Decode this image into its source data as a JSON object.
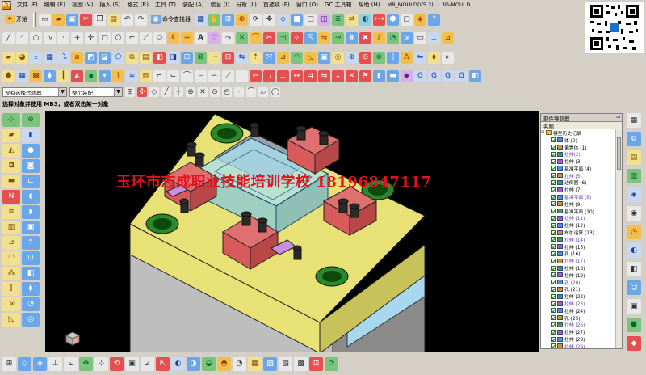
{
  "menubar": {
    "logo": "NX",
    "items": [
      "文件 (F)",
      "编辑 (E)",
      "视图 (V)",
      "插入 (S)",
      "格式 (R)",
      "工具 (T)",
      "装配 (A)",
      "信息 (I)",
      "分析 (L)",
      "首选项 (P)",
      "窗口 (O)",
      "GC 工具箱",
      "帮助 (H)"
    ],
    "window_title": "MB_MOULD(V5.2)",
    "window_title2": "3D-MOULD"
  },
  "toolbar": {
    "start_label": "开始",
    "command_finder_label": "命令查找器"
  },
  "selection": {
    "filter_value": "没有选择过滤器",
    "assembly_value": "整个装配",
    "cue_line": "选择对象并使用 MB3，或者双击某一对象"
  },
  "viewport": {
    "watermark": "玉环市志成职业技能培训学校  18196847117"
  },
  "navigator": {
    "title": "部件导航器",
    "column": "名称",
    "root": "模型历史记录",
    "features": [
      "体 (0)",
      "偏置体 (1)",
      "拉伸(2)",
      "拉伸 (3)",
      "基准平面 (4)",
      "拉伸 (5)",
      "边倒圆 (6)",
      "拉伸 (7)",
      "基准平面 (8)",
      "拉伸 (9)",
      "基准平面 (10)",
      "拉伸 (11)",
      "拉伸 (12)",
      "布尔运算 (13)",
      "拉伸 (14)",
      "拉伸 (15)",
      "孔 (16)",
      "拉伸 (17)",
      "拉伸 (18)",
      "拉伸 (19)",
      "孔 (20)",
      "孔 (21)",
      "拉伸 (22)",
      "拉伸 (23)",
      "拉伸 (24)",
      "孔 (25)",
      "拉伸 (26)",
      "拉伸 (27)",
      "拉伸 (28)",
      "拉伸 (29)"
    ]
  },
  "icons": {
    "menubar": "nx-logo-icon",
    "qr": "qr-code-icon"
  },
  "colors": {
    "plate_yellow": "#e8e276",
    "slider_red": "#d85a5a",
    "insert_cyan": "#9cd8e8",
    "watermark": "#e0141e",
    "viewport_bg": "#000000"
  }
}
